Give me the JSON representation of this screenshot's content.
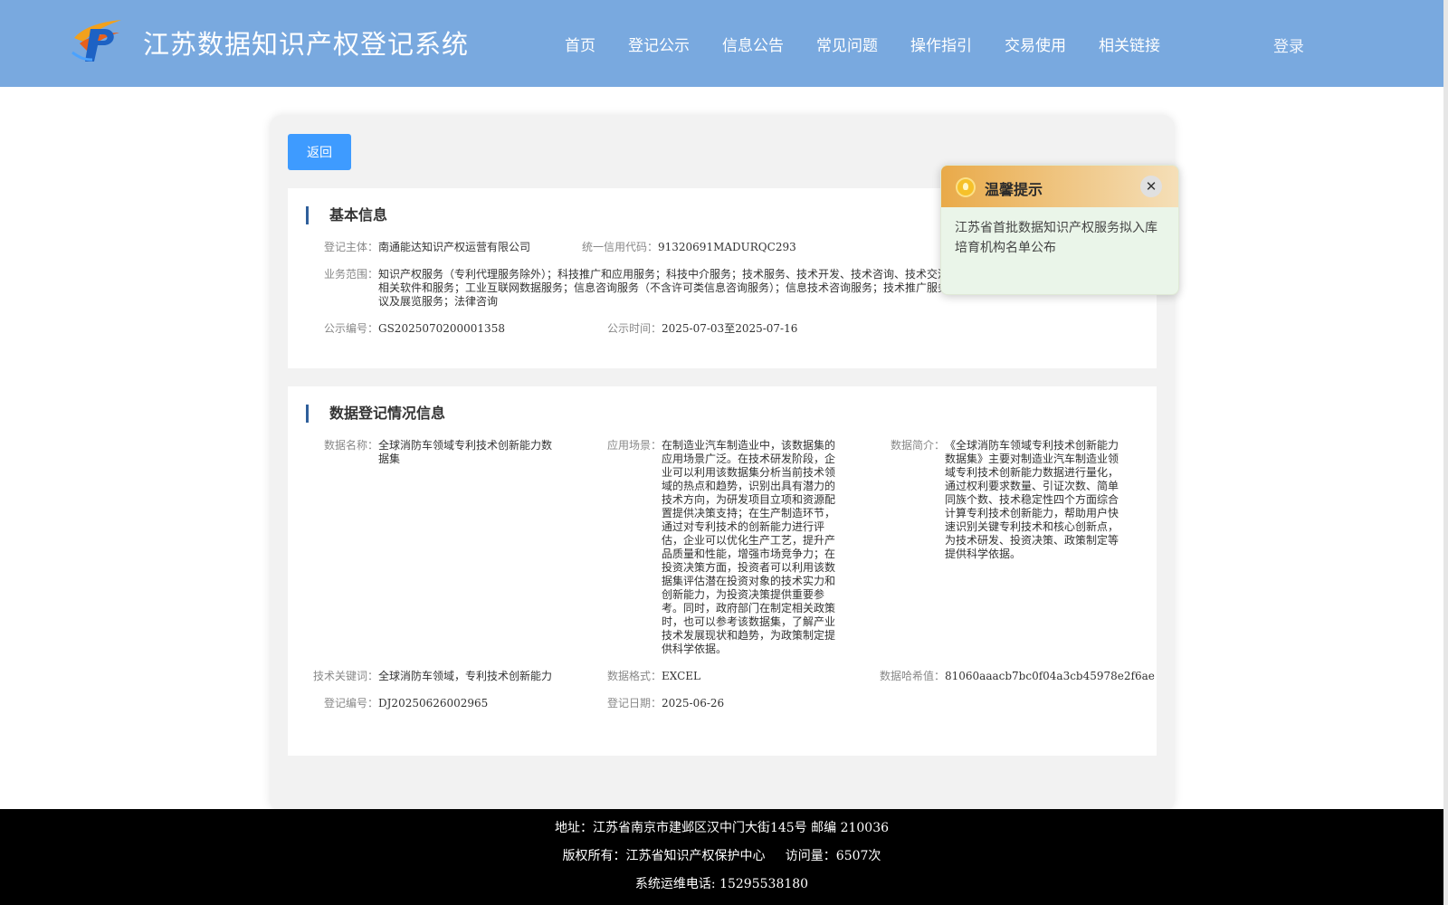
{
  "header": {
    "title": "江苏数据知识产权登记系统",
    "nav": [
      "首页",
      "登记公示",
      "信息公告",
      "常见问题",
      "操作指引",
      "交易使用",
      "相关链接"
    ],
    "login": "登录"
  },
  "back_label": "返回",
  "basic": {
    "title": "基本信息",
    "subject_label": "登记主体：",
    "subject_value": "南通能达知识产权运营有限公司",
    "credit_label": "统一信用代码：",
    "credit_value": "91320691MADURQC293",
    "scope_label": "业务范围：",
    "scope_value": "知识产权服务（专利代理服务除外）；科技推广和应用服务；科技中介服务；技术服务、技术开发、技术咨询、技术交流、技术转让、技术推广；区块链技术相关软件和服务；工业互联网数据服务；信息咨询服务（不含许可类信息咨询服务）；信息技术咨询服务；技术推广服务；知识产权代理（专利代理除外）；会议及展览服务；法律咨询",
    "pub_no_label": "公示编号：",
    "pub_no_value": "GS2025070200001358",
    "pub_time_label": "公示时间：",
    "pub_time_value": "2025-07-03至2025-07-16"
  },
  "data_info": {
    "title": "数据登记情况信息",
    "name_label": "数据名称：",
    "name_value": "全球消防车领域专利技术创新能力数据集",
    "scene_label": "应用场景：",
    "scene_value": "在制造业汽车制造业中，该数据集的应用场景广泛。在技术研发阶段，企业可以利用该数据集分析当前技术领域的热点和趋势，识别出具有潜力的技术方向，为研发项目立项和资源配置提供决策支持；在生产制造环节，通过对专利技术的创新能力进行评估，企业可以优化生产工艺，提升产品质量和性能，增强市场竞争力；在投资决策方面，投资者可以利用该数据集评估潜在投资对象的技术实力和创新能力，为投资决策提供重要参考。同时，政府部门在制定相关政策时，也可以参考该数据集，了解产业技术发展现状和趋势，为政策制定提供科学依据。",
    "intro_label": "数据简介：",
    "intro_value": "《全球消防车领域专利技术创新能力数据集》主要对制造业汽车制造业领域专利技术创新能力数据进行量化，通过权利要求数量、引证次数、简单同族个数、技术稳定性四个方面综合计算专利技术创新能力，帮助用户快速识别关键专利技术和核心创新点，为技术研发、投资决策、政策制定等提供科学依据。",
    "keyword_label": "技术关键词：",
    "keyword_value": "全球消防车领域，专利技术创新能力",
    "format_label": "数据格式：",
    "format_value": "EXCEL",
    "hash_label": "数据哈希值：",
    "hash_value": "81060aaacb7bc0f04a3cb45978e2f6ae",
    "reg_no_label": "登记编号：",
    "reg_no_value": "DJ20250626002965",
    "reg_date_label": "登记日期：",
    "reg_date_value": "2025-06-26"
  },
  "popup": {
    "title": "温馨提示",
    "close": "✕",
    "message": "江苏省首批数据知识产权服务拟入库培育机构名单公布"
  },
  "footer": {
    "address": "地址：江苏省南京市建邺区汉中门大街145号 邮编 210036",
    "copyright": "版权所有：江苏省知识产权保护中心     访问量：6507次",
    "phone": "系统运维电话: 15295538180"
  },
  "colors": {
    "header_bg": "#79a9df",
    "button_blue": "#3e9bff",
    "section_bar": "#2f5f9b",
    "footer_bg": "#000000"
  }
}
